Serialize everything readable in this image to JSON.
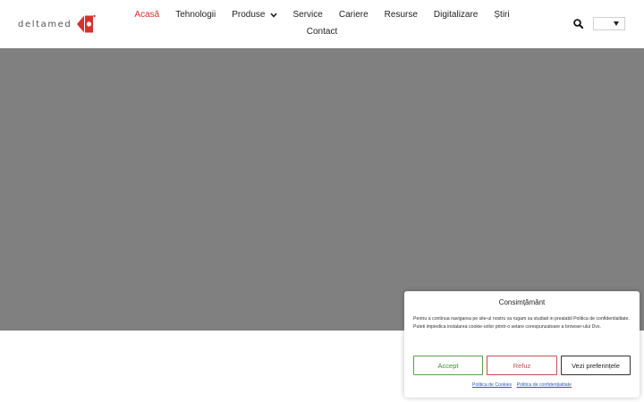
{
  "header": {
    "logo": {
      "text": "deltamed",
      "brand_red": "#d6312f"
    },
    "nav": {
      "items": [
        {
          "label": "Acasă",
          "active": true
        },
        {
          "label": "Tehnologii"
        },
        {
          "label": "Produse",
          "has_dropdown": true,
          "icon": "chevron-down-icon"
        },
        {
          "label": "Service"
        },
        {
          "label": "Cariere"
        },
        {
          "label": "Resurse"
        },
        {
          "label": "Digitalizare"
        },
        {
          "label": "Știri"
        }
      ],
      "contact": {
        "label": "Contact"
      },
      "active_color": "#d6312f"
    },
    "search": {
      "icon": "search-icon"
    },
    "language_select": {
      "value": "",
      "icon": "caret-down-icon"
    }
  },
  "hero": {
    "background": "#808080"
  },
  "consent": {
    "title": "Consimțământ",
    "text": "Pentru a continua navigarea pe site-ul nostru va rugam sa studiati in prealabil Politica de confidentialitate. Puteti impiedica instalarea cookie-urilor printr-o setare corespunzatoare a browser-ului Dvs.",
    "buttons": {
      "accept": "Accept",
      "refuse": "Refuz",
      "preferences": "Vezi preferințele"
    },
    "links": {
      "cookies": "Politica de Cookies",
      "privacy": "Politica de confidențialitate"
    }
  }
}
